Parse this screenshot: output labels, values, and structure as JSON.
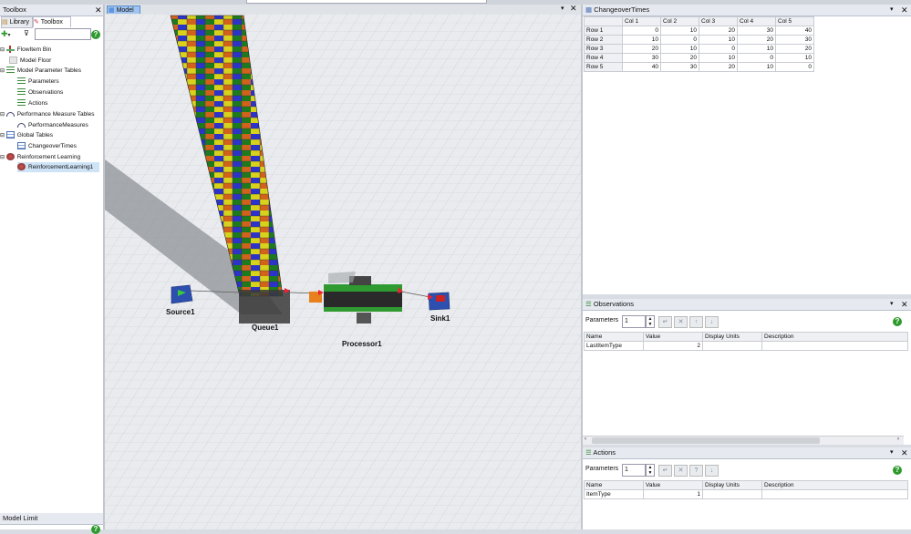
{
  "toolbox": {
    "title": "Toolbox",
    "tabs": [
      "Library",
      "Toolbox"
    ],
    "search_placeholder": "",
    "items": [
      {
        "label": "FlowItem Bin",
        "icon": "flowitem-bin-icon"
      },
      {
        "label": "Model Floor",
        "icon": "model-floor-icon"
      },
      {
        "label": "Model Parameter Tables",
        "icon": "parameter-tables-icon"
      },
      {
        "label": "Parameters",
        "icon": "parameters-icon"
      },
      {
        "label": "Observations",
        "icon": "observations-icon"
      },
      {
        "label": "Actions",
        "icon": "actions-icon"
      },
      {
        "label": "Performance Measure Tables",
        "icon": "performance-icon"
      },
      {
        "label": "PerformanceMeasures",
        "icon": "performance-measures-icon"
      },
      {
        "label": "Global Tables",
        "icon": "global-tables-icon"
      },
      {
        "label": "ChangeoverTimes",
        "icon": "table-icon"
      },
      {
        "label": "Reinforcement Learning",
        "icon": "rl-icon"
      },
      {
        "label": "ReinforcementLearning1",
        "icon": "rl-object-icon"
      }
    ],
    "bottom_panel_title": "Model Limit"
  },
  "model": {
    "tab_label": "Model",
    "objects": {
      "source": "Source1",
      "queue": "Queue1",
      "processor": "Processor1",
      "sink": "Sink1"
    }
  },
  "changeover": {
    "title": "ChangeoverTimes",
    "columns": [
      "Col 1",
      "Col 2",
      "Col 3",
      "Col 4",
      "Col 5"
    ],
    "rows": [
      {
        "label": "Row 1",
        "values": [
          "0",
          "10",
          "20",
          "30",
          "40"
        ]
      },
      {
        "label": "Row 2",
        "values": [
          "10",
          "0",
          "10",
          "20",
          "30"
        ]
      },
      {
        "label": "Row 3",
        "values": [
          "20",
          "10",
          "0",
          "10",
          "20"
        ]
      },
      {
        "label": "Row 4",
        "values": [
          "30",
          "20",
          "10",
          "0",
          "10"
        ]
      },
      {
        "label": "Row 5",
        "values": [
          "40",
          "30",
          "20",
          "10",
          "0"
        ]
      }
    ]
  },
  "observations": {
    "title": "Observations",
    "params_label": "Parameters",
    "params_value": "1",
    "columns": [
      "Name",
      "Value",
      "Display Units",
      "Description"
    ],
    "rows": [
      {
        "name": "LastItemType",
        "value": "2",
        "units": "",
        "description": ""
      }
    ]
  },
  "actions": {
    "title": "Actions",
    "params_label": "Parameters",
    "params_value": "1",
    "columns": [
      "Name",
      "Value",
      "Display Units",
      "Description"
    ],
    "rows": [
      {
        "name": "ItemType",
        "value": "1",
        "units": "",
        "description": ""
      }
    ]
  },
  "colors": {
    "tab_accent": "#3a7bd5",
    "help_green": "#2e9a2e"
  }
}
